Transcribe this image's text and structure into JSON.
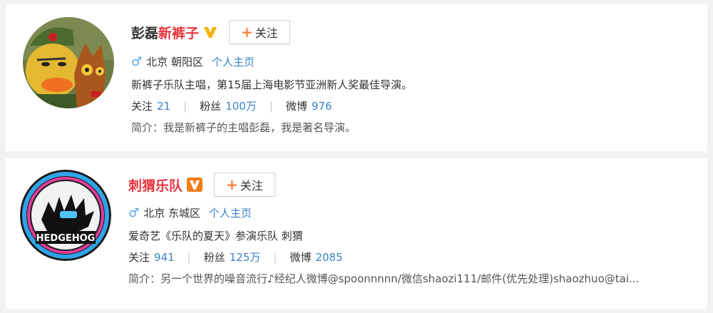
{
  "users": [
    {
      "name_black": "彭磊",
      "name_red": "新裤子",
      "follow_label": "关注",
      "location": "北京 朝阳区",
      "homepage": "个人主页",
      "description": "新裤子乐队主唱，第15届上海电影节亚洲新人奖最佳导演。",
      "stats": {
        "following_label": "关注",
        "following": "21",
        "fans_label": "粉丝",
        "fans": "100万",
        "weibo_label": "微博",
        "weibo": "976"
      },
      "bio_label": "简介：",
      "bio": "我是新裤子的主唱彭磊，我是著名导演。",
      "verify_color": "#f6b300"
    },
    {
      "name_black": "",
      "name_red": "刺猬乐队",
      "follow_label": "关注",
      "location": "北京 东城区",
      "homepage": "个人主页",
      "description": "爱奇艺《乐队的夏天》参演乐队 刺猬",
      "stats": {
        "following_label": "关注",
        "following": "941",
        "fans_label": "粉丝",
        "fans": "125万",
        "weibo_label": "微博",
        "weibo": "2085"
      },
      "bio_label": "简介：",
      "bio": "另一个世界的噪音流行♪经纪人微博@spoonnnnn/微信shaozi111/邮件(优先处理)shaozhuo@tai...",
      "verify_color": "#f07d17",
      "avatar_text": "HEDGEHOG"
    }
  ],
  "colors": {
    "link": "#3c82c8",
    "red_name": "#e8333e",
    "plus": "#ff8140",
    "male": "#5ba5e2"
  }
}
